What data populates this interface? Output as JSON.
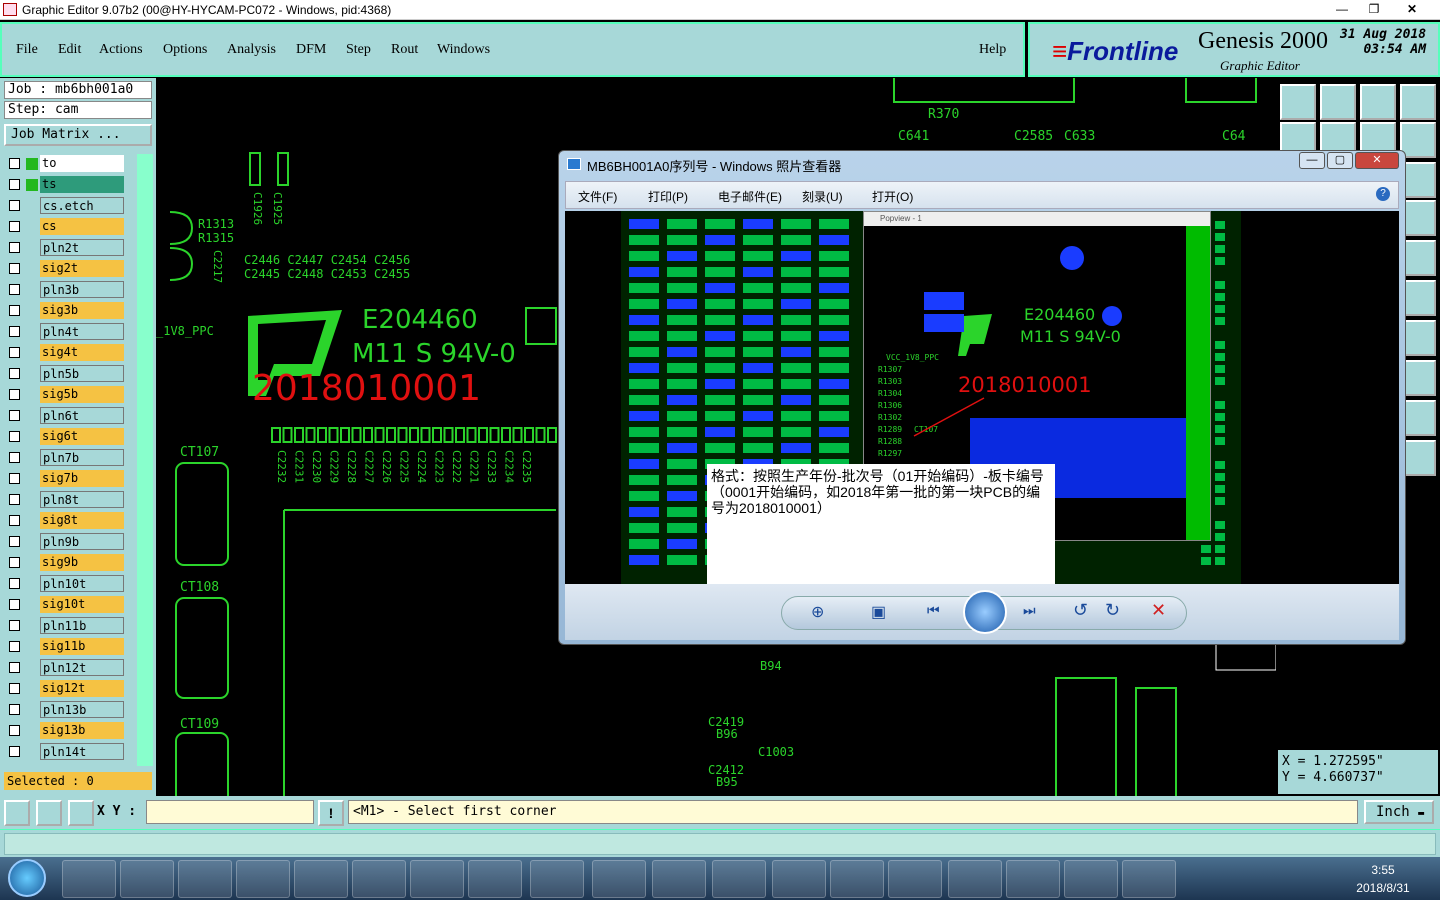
{
  "window": {
    "title": "Graphic Editor 9.07b2 (00@HY-HYCAM-PC072 - Windows, pid:4368)"
  },
  "menu": [
    "File",
    "Edit",
    "Actions",
    "Options",
    "Analysis",
    "DFM",
    "Step",
    "Rout",
    "Windows"
  ],
  "help": "Help",
  "brand": {
    "logo": "Frontline",
    "product": "Genesis 2000",
    "subtitle": "Graphic Editor",
    "date": "31 Aug 2018",
    "time": "03:54 AM"
  },
  "job": {
    "job_label": "Job  : mb6bh001a0",
    "step_label": "Step: cam",
    "matrix_button": "Job Matrix ..."
  },
  "layers": [
    {
      "name": "to",
      "type": "silk",
      "bg": "#ffffff"
    },
    {
      "name": "ts",
      "type": "mask",
      "bg": "#2e9b7b"
    },
    {
      "name": "cs.etch",
      "type": "plane"
    },
    {
      "name": "cs",
      "type": "board"
    },
    {
      "name": "pln2t",
      "type": "plane"
    },
    {
      "name": "sig2t",
      "type": "board"
    },
    {
      "name": "pln3b",
      "type": "plane"
    },
    {
      "name": "sig3b",
      "type": "board"
    },
    {
      "name": "pln4t",
      "type": "plane"
    },
    {
      "name": "sig4t",
      "type": "board"
    },
    {
      "name": "pln5b",
      "type": "plane"
    },
    {
      "name": "sig5b",
      "type": "board"
    },
    {
      "name": "pln6t",
      "type": "plane"
    },
    {
      "name": "sig6t",
      "type": "board"
    },
    {
      "name": "pln7b",
      "type": "plane"
    },
    {
      "name": "sig7b",
      "type": "board"
    },
    {
      "name": "pln8t",
      "type": "plane"
    },
    {
      "name": "sig8t",
      "type": "board"
    },
    {
      "name": "pln9b",
      "type": "plane"
    },
    {
      "name": "sig9b",
      "type": "board"
    },
    {
      "name": "pln10t",
      "type": "plane"
    },
    {
      "name": "sig10t",
      "type": "board"
    },
    {
      "name": "pln11b",
      "type": "plane"
    },
    {
      "name": "sig11b",
      "type": "board"
    },
    {
      "name": "pln12t",
      "type": "plane"
    },
    {
      "name": "sig12t",
      "type": "board"
    },
    {
      "name": "pln13b",
      "type": "plane"
    },
    {
      "name": "sig13b",
      "type": "board"
    },
    {
      "name": "pln14t",
      "type": "plane"
    }
  ],
  "selected": "Selected : 0",
  "status": {
    "xy_label": "X Y :",
    "xy_value": "",
    "message": "<M1> - Select first corner",
    "unit": "Inch",
    "warn_icon": "!"
  },
  "coords": {
    "x": "X  =  1.272595\"",
    "y": "Y  =  4.660737\""
  },
  "canvas": {
    "ul_logo": "E204460",
    "ul_spec": "M11 S 94V-0",
    "serial": "2018010001",
    "refdes_top": [
      "C2446 C2447 C2454 C2456",
      "C2445 C2448 C2453 C2455"
    ],
    "r_labels": [
      "R1313",
      "R1315"
    ],
    "c_vert": [
      "C1926",
      "C1925"
    ],
    "c2217": "C2217",
    "net": "_1V8_PPC",
    "ct": [
      "CT107",
      "CT108",
      "CT109"
    ],
    "row_caps": [
      "C2232",
      "C2231",
      "C2230",
      "C2229",
      "C2228",
      "C2227",
      "C2226",
      "C2225",
      "C2224",
      "C2223",
      "C2222",
      "C2221",
      "C2233",
      "C2234",
      "C2235"
    ],
    "top_labels": [
      "R370",
      "C641",
      "C2585",
      "C633",
      "C64"
    ],
    "bottom_labels": [
      "B94",
      "C2419",
      "B96",
      "C1003",
      "C2412",
      "B95"
    ]
  },
  "viewer": {
    "title": "MB6BH001A0序列号 - Windows 照片查看器",
    "menu": [
      "文件(F)",
      "打印(P)",
      "电子邮件(E)",
      "刻录(U)",
      "打开(O)"
    ],
    "popup_title": "Popview - 1",
    "popup_serial": "2018010001",
    "popup_ul": "E204460",
    "popup_spec": "M11 S 94V-0",
    "popup_labels": [
      "R1307",
      "R1303",
      "R1304",
      "R1306",
      "R1302",
      "R1289",
      "R1288",
      "R1297"
    ],
    "popup_net": "VCC_1V8_PPC",
    "popup_ct": "CT107",
    "note": "格式：按照生产年份-批次号（01开始编码）-板卡编号（0001开始编码，如2018年第一批的第一块PCB的编号为2018010001）"
  },
  "taskbar": {
    "time": "3:55",
    "date": "2018/8/31"
  },
  "colors": {
    "panel": "#a7d8d8",
    "board_layer": "#f5c243",
    "pcb_green": "#2bd42b",
    "serial_red": "#e01010"
  }
}
